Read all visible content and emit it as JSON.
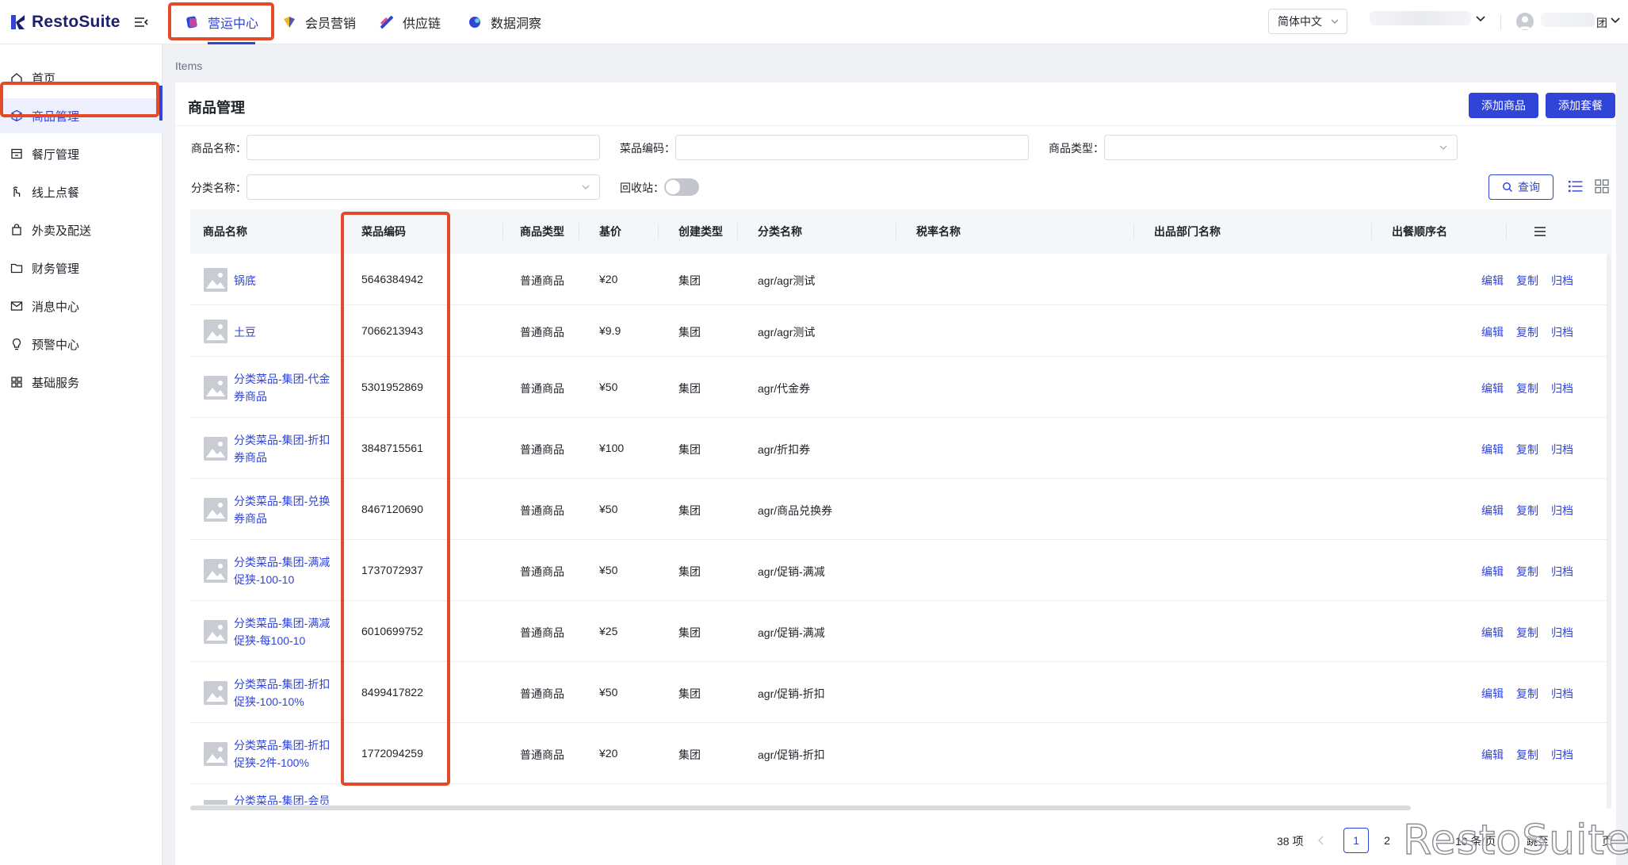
{
  "app": {
    "name": "RestoSuite"
  },
  "top_nav": {
    "tabs": [
      {
        "label": "营运中心",
        "icon": "operations-icon",
        "active": true
      },
      {
        "label": "会员营销",
        "icon": "member-marketing-icon",
        "active": false
      },
      {
        "label": "供应链",
        "icon": "supply-chain-icon",
        "active": false
      },
      {
        "label": "数据洞察",
        "icon": "data-insight-icon",
        "active": false
      }
    ],
    "language": "简体中文",
    "user_suffix": "团"
  },
  "sidebar": {
    "items": [
      {
        "label": "首页",
        "icon": "home-icon",
        "active": false
      },
      {
        "label": "商品管理",
        "icon": "cube-icon",
        "active": true
      },
      {
        "label": "餐厅管理",
        "icon": "store-icon",
        "active": false
      },
      {
        "label": "线上点餐",
        "icon": "hand-pointer-icon",
        "active": false
      },
      {
        "label": "外卖及配送",
        "icon": "bag-icon",
        "active": false
      },
      {
        "label": "财务管理",
        "icon": "folder-icon",
        "active": false
      },
      {
        "label": "消息中心",
        "icon": "mail-icon",
        "active": false
      },
      {
        "label": "预警中心",
        "icon": "bulb-icon",
        "active": false
      },
      {
        "label": "基础服务",
        "icon": "grid-icon",
        "active": false
      }
    ]
  },
  "breadcrumb": "Items",
  "page": {
    "title": "商品管理",
    "add_item_label": "添加商品",
    "add_combo_label": "添加套餐",
    "query_label": "查询"
  },
  "filters": {
    "item_name_label": "商品名称：",
    "item_code_label": "菜品编码：",
    "item_type_label": "商品类型：",
    "category_label": "分类名称：",
    "recycle_label": "回收站：",
    "recycle_on": false
  },
  "table": {
    "columns": [
      "商品名称",
      "菜品编码",
      "商品类型",
      "基价",
      "创建类型",
      "分类名称",
      "税率名称",
      "出品部门名称",
      "出餐顺序名"
    ],
    "rows": [
      {
        "name": "锅底",
        "code": "5646384942",
        "type": "普通商品",
        "price": "¥20",
        "creator": "集团",
        "category": "agr/agr测试"
      },
      {
        "name": "土豆",
        "code": "7066213943",
        "type": "普通商品",
        "price": "¥9.9",
        "creator": "集团",
        "category": "agr/agr测试"
      },
      {
        "name": "分类菜品-集团-代金券商品",
        "code": "5301952869",
        "type": "普通商品",
        "price": "¥50",
        "creator": "集团",
        "category": "agr/代金券"
      },
      {
        "name": "分类菜品-集团-折扣券商品",
        "code": "3848715561",
        "type": "普通商品",
        "price": "¥100",
        "creator": "集团",
        "category": "agr/折扣券"
      },
      {
        "name": "分类菜品-集团-兑换券商品",
        "code": "8467120690",
        "type": "普通商品",
        "price": "¥50",
        "creator": "集团",
        "category": "agr/商品兑换券"
      },
      {
        "name": "分类菜品-集团-满减促狭-100-10",
        "code": "1737072937",
        "type": "普通商品",
        "price": "¥50",
        "creator": "集团",
        "category": "agr/促销-满减"
      },
      {
        "name": "分类菜品-集团-满减促狭-每100-10",
        "code": "6010699752",
        "type": "普通商品",
        "price": "¥25",
        "creator": "集团",
        "category": "agr/促销-满减"
      },
      {
        "name": "分类菜品-集团-折扣促狭-100-10%",
        "code": "8499417822",
        "type": "普通商品",
        "price": "¥50",
        "creator": "集团",
        "category": "agr/促销-折扣"
      },
      {
        "name": "分类菜品-集团-折扣促狭-2件-100%",
        "code": "1772094259",
        "type": "普通商品",
        "price": "¥20",
        "creator": "集团",
        "category": "agr/促销-折扣"
      }
    ],
    "partial_row_name": "分类菜品-集团-会员",
    "actions": {
      "edit": "编辑",
      "copy": "复制",
      "archive": "归档"
    }
  },
  "pagination": {
    "total": "38 项",
    "pages": [
      "1",
      "2"
    ],
    "current": "1",
    "page_size": "10 条/页",
    "jump_label": "跳至",
    "suffix": "页"
  },
  "watermark": "RestoSuite",
  "colors": {
    "primary": "#3044d8",
    "highlight": "#e34a2a"
  }
}
